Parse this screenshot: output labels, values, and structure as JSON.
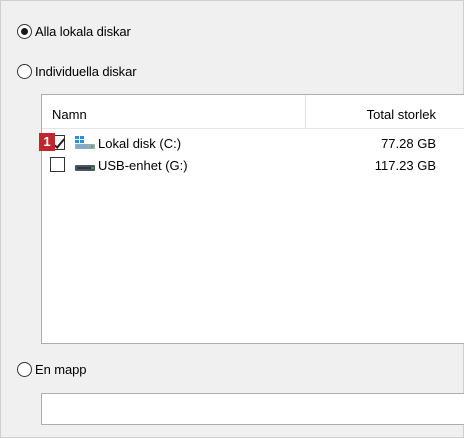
{
  "scope_options": {
    "all_local": {
      "label": "Alla lokala diskar",
      "selected": true
    },
    "individual": {
      "label": "Individuella diskar",
      "selected": false
    },
    "folder": {
      "label": "En mapp",
      "selected": false
    }
  },
  "disk_list": {
    "columns": {
      "name": "Namn",
      "size": "Total storlek"
    },
    "rows": [
      {
        "name": "Lokal disk (C:)",
        "size": "77.28 GB",
        "checked": true,
        "icon": "system-drive-icon"
      },
      {
        "name": "USB-enhet (G:)",
        "size": "117.23 GB",
        "checked": false,
        "icon": "usb-drive-icon"
      }
    ]
  },
  "step_badge": "1",
  "folder_input": {
    "value": "",
    "placeholder": ""
  },
  "colors": {
    "window_bg": "#f0f0f0",
    "list_bg": "#ffffff",
    "border": "#adadad",
    "badge": "#c0262d"
  }
}
